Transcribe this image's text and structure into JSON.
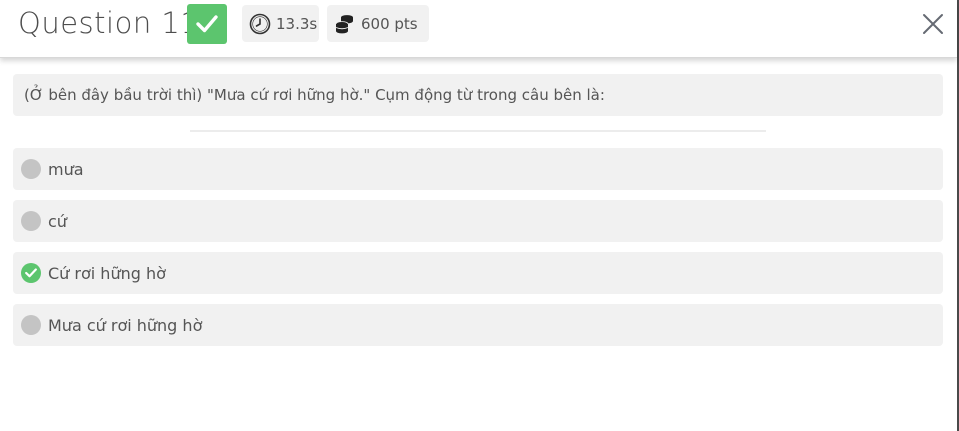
{
  "header": {
    "title": "Question 11",
    "status_icon": "check-icon",
    "status_color": "#5cc56e",
    "timer": {
      "icon": "clock-icon",
      "value": "13.3s"
    },
    "points": {
      "icon": "coins-icon",
      "value": "600 pts"
    },
    "close_icon": "close-icon"
  },
  "question": {
    "text": "(Ở bên đây bầu trời thì) \"Mưa cứ rơi hững hờ.\" Cụm động từ trong câu bên là:"
  },
  "options": [
    {
      "label": "mưa",
      "state": "unselected"
    },
    {
      "label": "cứ",
      "state": "unselected"
    },
    {
      "label": "Cứ rơi hững hờ",
      "state": "correct"
    },
    {
      "label": "Mưa cứ rơi hững hờ",
      "state": "unselected"
    }
  ],
  "colors": {
    "correct": "#5cc56e",
    "option_bg": "#f1f1f1",
    "radio_idle": "#c4c4c4"
  }
}
